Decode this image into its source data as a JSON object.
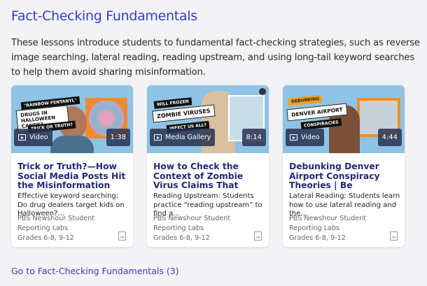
{
  "section": {
    "title": "Fact-Checking Fundamentals",
    "description": "These lessons introduce students to fundamental fact-checking strategies, such as reverse image searching, lateral reading, reading upstream, and using long-tail keyword searches to help them avoid sharing misinformation."
  },
  "cards": [
    {
      "type": "Video",
      "type_icon": "play-icon",
      "duration": "1:38",
      "thumb_text": [
        "\"RAINBOW FENTANYL\"",
        "DRUGS IN HALLOWEEN CANDY?",
        "TRICK OR TRUTH?"
      ],
      "title": "Trick or Truth?—How Social Media Posts Hit the Misinformation Sweet...",
      "summary": "Effective keyword searching: Do drug dealers target kids on Halloween?...",
      "source": "PBS Newshour Student Reporting Labs",
      "grades": "Grades 6-8, 9-12",
      "file_icon": "SM"
    },
    {
      "type": "Media Gallery",
      "type_icon": "gallery-icon",
      "duration": "8:14",
      "thumb_text": [
        "WILL FROZEN",
        "ZOMBIE VIRUSES",
        "INFECT US ALL?"
      ],
      "title": "How to Check the Context of Zombie Virus Claims That Keep Coming Back t...",
      "summary": "Reading Upstream: Students practice “reading upstream” to find a...",
      "source": "PBS Newshour Student Reporting Labs",
      "grades": "Grades 6-8, 9-12",
      "file_icon": "SM"
    },
    {
      "type": "Video",
      "type_icon": "play-icon",
      "duration": "4:44",
      "thumb_text": [
        "DEBUNKING",
        "DENVER AIRPORT",
        "CONSPIRACIES"
      ],
      "title": "Debunking Denver Airport Conspiracy Theories | Be MediaWise",
      "summary": "Lateral Reading: Students learn how to use lateral reading and the...",
      "source": "PBS Newshour Student Reporting Labs",
      "grades": "Grades 6-8, 9-12",
      "file_icon": "SM"
    }
  ],
  "footer_link": "Go to Fact-Checking Fundamentals (3)"
}
